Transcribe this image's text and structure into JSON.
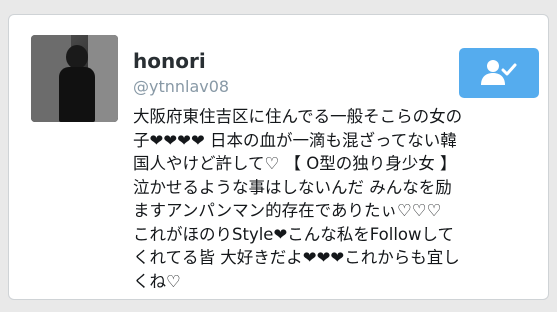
{
  "user": {
    "name": "honori",
    "handle": "@ytnnlav08"
  },
  "follow_button": {
    "icon": "follow-person-check-icon",
    "color": "#55acee"
  },
  "tweet": {
    "lines": [
      "大阪府東住吉区に住んでる一般そこらの女の",
      "子❤❤❤❤ 日本の血が一滴も混ざってない韓",
      "国人やけど許して♡ 【 O型の独り身少女 】",
      "泣かせるような事はしないんだ みんなを励",
      "ますアンパンマン的存在でありたぃ♡♡♡",
      "これがほのりStyle❤こんな私をFollowして",
      "くれてる皆 大好きだよ❤❤❤これからも宜し",
      "くね♡"
    ]
  }
}
